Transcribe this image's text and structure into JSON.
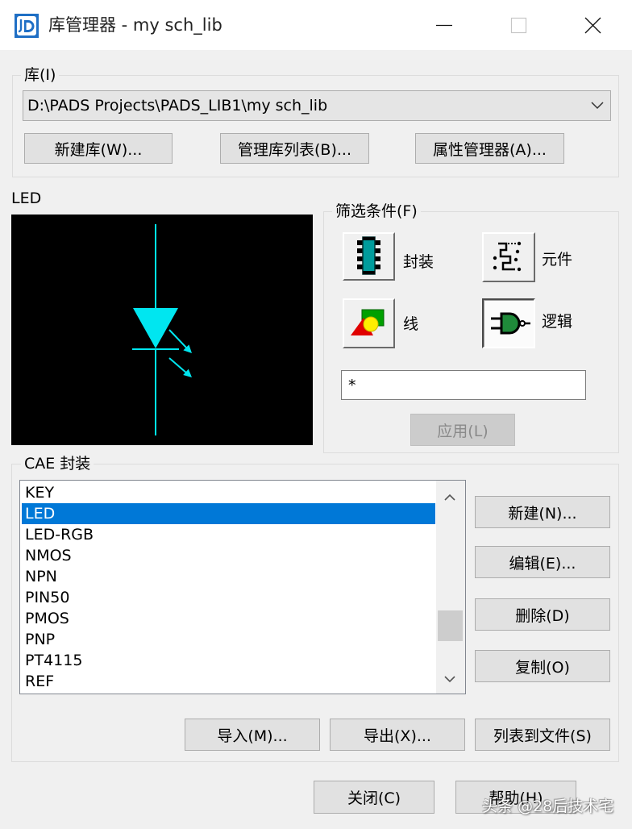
{
  "window": {
    "title": "库管理器 - my sch_lib",
    "app_icon": "pads-library-app-icon",
    "controls": {
      "minimize": "minimize-icon",
      "maximize": "maximize-icon",
      "maximize_enabled": false,
      "close": "close-icon"
    }
  },
  "library_group": {
    "label": "库(I)",
    "path": "D:\\PADS Projects\\PADS_LIB1\\my sch_lib",
    "buttons": {
      "new_library": "新建库(W)...",
      "library_list": "管理库列表(B)...",
      "attribute_manager": "属性管理器(A)..."
    }
  },
  "preview": {
    "label": "LED",
    "symbol": "led-schematic-symbol"
  },
  "filter_group": {
    "label": "筛选条件(F)",
    "options": [
      {
        "label": "封装",
        "icon": "package-icon",
        "pressed": false
      },
      {
        "label": "元件",
        "icon": "part-icon",
        "pressed": false
      },
      {
        "label": "线",
        "icon": "lines-shapes-icon",
        "pressed": false
      },
      {
        "label": "逻辑",
        "icon": "logic-gate-icon",
        "pressed": true
      }
    ],
    "filter_value": "*",
    "apply_label": "应用(L)",
    "apply_enabled": false
  },
  "cae_group": {
    "label": "CAE 封装",
    "items": [
      "KEY",
      "LED",
      "LED-RGB",
      "NMOS",
      "NPN",
      "PIN50",
      "PMOS",
      "PNP",
      "PT4115",
      "REF"
    ],
    "selected": "LED",
    "scroll_position": 0.82,
    "buttons": {
      "new": "新建(N)...",
      "edit": "编辑(E)...",
      "delete": "删除(D)",
      "copy": "复制(O)",
      "import": "导入(M)...",
      "export": "导出(X)...",
      "list_to_file": "列表到文件(S)"
    }
  },
  "dialog_buttons": {
    "close": "关闭(C)",
    "help": "帮助(H)"
  },
  "watermark": "头条 @28后技术宅",
  "colors": {
    "window_bg": "#f0f0f0",
    "selection": "#0078d7",
    "preview_background": "#000000",
    "symbol": "#00e6f0"
  }
}
